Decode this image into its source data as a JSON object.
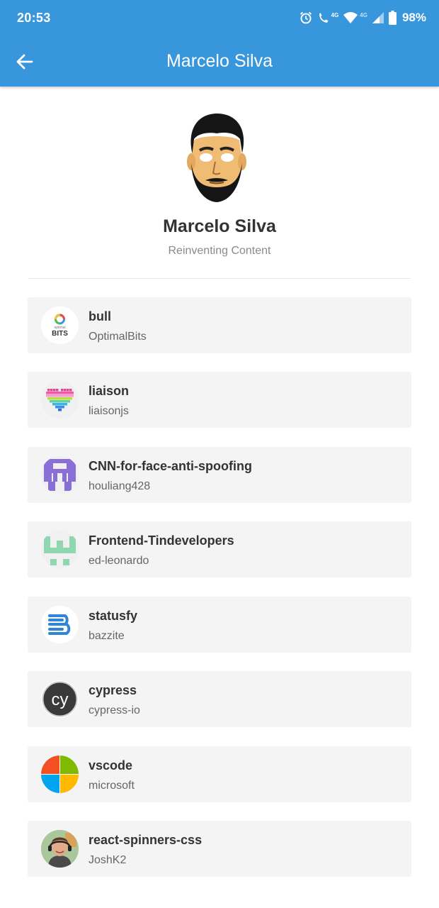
{
  "status_bar": {
    "time": "20:53",
    "battery": "98%",
    "icons": [
      "alarm-icon",
      "volte-call-icon",
      "wifi-icon",
      "signal-icon",
      "battery-icon"
    ],
    "label_4g": "4G"
  },
  "app_bar": {
    "title": "Marcelo Silva",
    "back_icon": "arrow-back-icon",
    "color": "#3796dc"
  },
  "profile": {
    "name": "Marcelo Silva",
    "bio": "Reinventing Content"
  },
  "repositories": [
    {
      "name": "bull",
      "owner": "OptimalBits",
      "logo": "optimalbits-logo"
    },
    {
      "name": "liaison",
      "owner": "liaisonjs",
      "logo": "pixel-heart-logo"
    },
    {
      "name": "CNN-for-face-anti-spoofing",
      "owner": "houliang428",
      "logo": "purple-identicon"
    },
    {
      "name": "Frontend-Tindevelopers",
      "owner": "ed-leonardo",
      "logo": "green-identicon"
    },
    {
      "name": "statusfy",
      "owner": "bazzite",
      "logo": "statusfy-logo"
    },
    {
      "name": "cypress",
      "owner": "cypress-io",
      "logo": "cypress-logo"
    },
    {
      "name": "vscode",
      "owner": "microsoft",
      "logo": "microsoft-logo"
    },
    {
      "name": "react-spinners-css",
      "owner": "JoshK2",
      "logo": "user-photo-avatar"
    }
  ]
}
